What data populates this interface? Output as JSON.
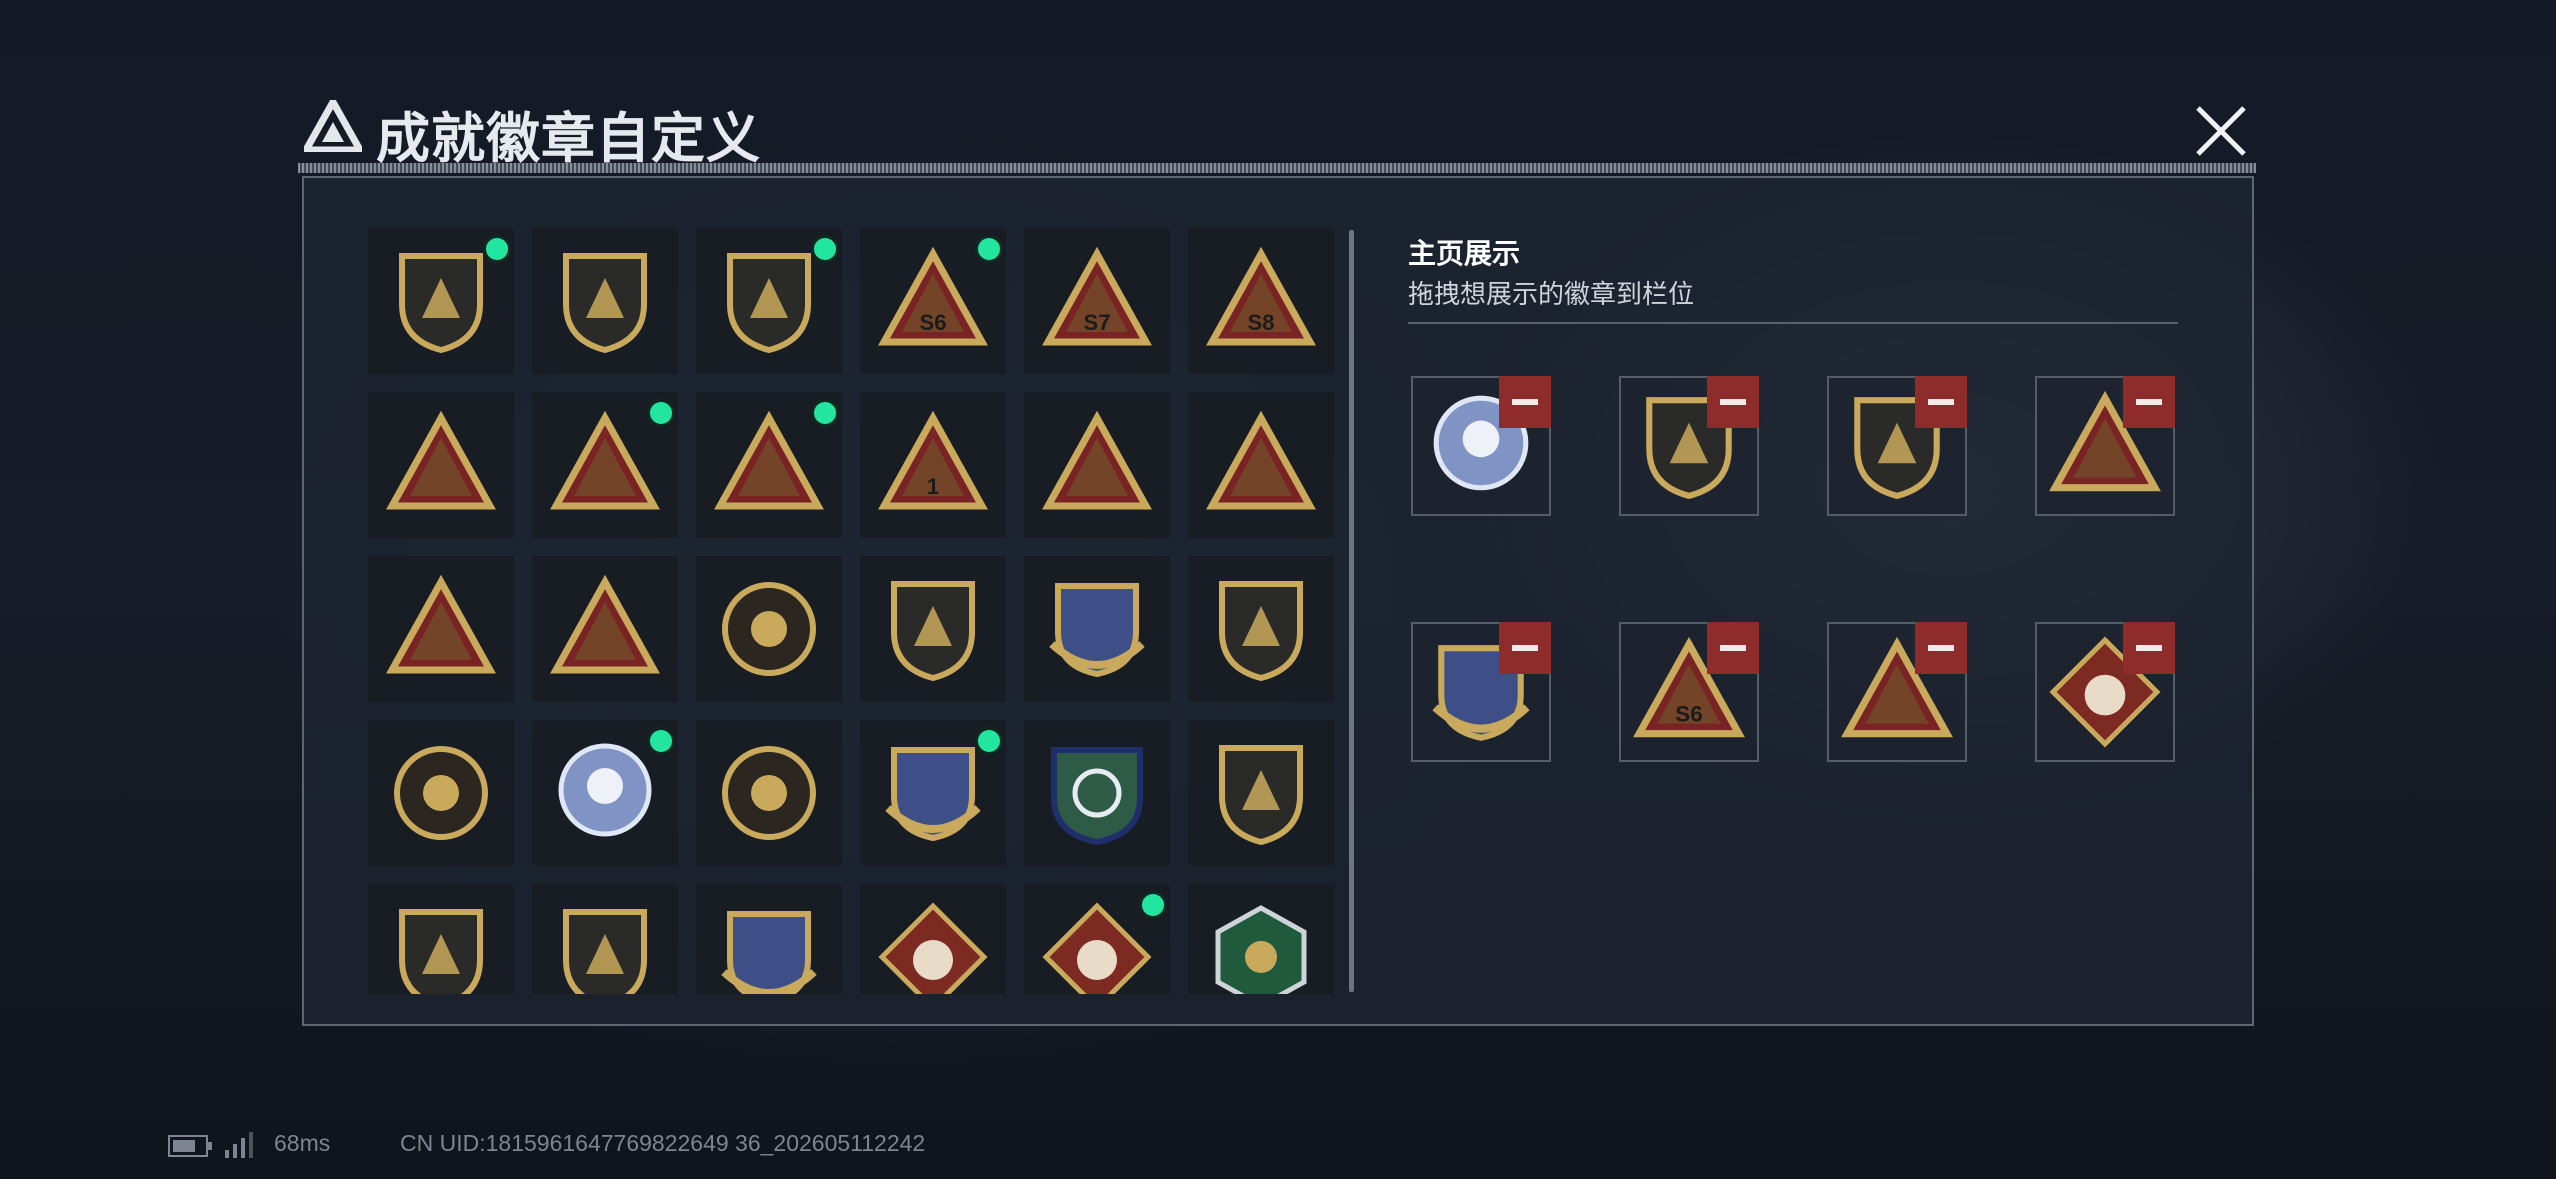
{
  "title": "成就徽章自定义",
  "showcase": {
    "title": "主页展示",
    "subtitle": "拖拽想展示的徽章到栏位"
  },
  "footer": {
    "ping": "68ms",
    "uid": "CN UID:1815961647769822649 36_202605112242"
  },
  "badges": [
    {
      "icon": "shield-delta-badge-icon",
      "new": true
    },
    {
      "icon": "helicopter-shield-badge-icon",
      "new": false
    },
    {
      "icon": "dagger-shield-badge-icon",
      "new": true
    },
    {
      "icon": "s6-triangle-badge-icon",
      "new": true,
      "label": "S6"
    },
    {
      "icon": "s7-triangle-badge-icon",
      "new": false,
      "label": "S7"
    },
    {
      "icon": "s8-triangle-badge-icon",
      "new": false,
      "label": "S8"
    },
    {
      "icon": "missile-launcher-triangle-badge-icon",
      "new": false
    },
    {
      "icon": "medal-triangle-badge-icon",
      "new": true
    },
    {
      "icon": "boat-triangle-badge-icon",
      "new": true
    },
    {
      "icon": "number-one-triangle-badge-icon",
      "new": false,
      "label": "1"
    },
    {
      "icon": "bunker-triangle-badge-icon",
      "new": false
    },
    {
      "icon": "hands-triangle-badge-icon",
      "new": false
    },
    {
      "icon": "soldiers-triangle-badge-icon",
      "new": false
    },
    {
      "icon": "rocket-triangle-badge-icon",
      "new": false
    },
    {
      "icon": "star-round-badge-icon",
      "new": false
    },
    {
      "icon": "chevron-shield-badge-icon",
      "new": false
    },
    {
      "icon": "wreath-shield-badge-icon",
      "new": false
    },
    {
      "icon": "geo-shield-badge-icon",
      "new": false
    },
    {
      "icon": "eye-round-badge-icon",
      "new": false
    },
    {
      "icon": "skull-crosshair-badge-icon",
      "new": true
    },
    {
      "icon": "tank-burst-badge-icon",
      "new": false
    },
    {
      "icon": "sniper-wreath-badge-icon",
      "new": true
    },
    {
      "icon": "green-crosshair-badge-icon",
      "new": false
    },
    {
      "icon": "rifle-shield-badge-icon",
      "new": false
    },
    {
      "icon": "rifle-shield-alt-badge-icon",
      "new": false
    },
    {
      "icon": "sniper-shield-badge-icon",
      "new": false
    },
    {
      "icon": "crosshair-wreath-badge-icon",
      "new": false
    },
    {
      "icon": "wolf-diamond-badge-icon",
      "new": false
    },
    {
      "icon": "wolf-diamond-alt-badge-icon",
      "new": true
    },
    {
      "icon": "hornet-hex-badge-icon",
      "new": false
    }
  ],
  "slots": [
    {
      "icon": "skull-crosshair-badge-icon"
    },
    {
      "icon": "shield-delta-badge-icon"
    },
    {
      "icon": "dagger-shield-badge-icon"
    },
    {
      "icon": "medal-triangle-badge-icon"
    },
    {
      "icon": "sniper-wreath-badge-icon"
    },
    {
      "icon": "s6-triangle-badge-icon",
      "label": "S6"
    },
    {
      "icon": "boat-triangle-badge-icon"
    },
    {
      "icon": "wolf-diamond-badge-icon"
    }
  ],
  "colors": {
    "gold": "#c9a95c",
    "gold_dark": "#6e5a2c",
    "red": "#7a2324",
    "new_dot": "#22e6a0",
    "remove": "#8e2b2b"
  }
}
